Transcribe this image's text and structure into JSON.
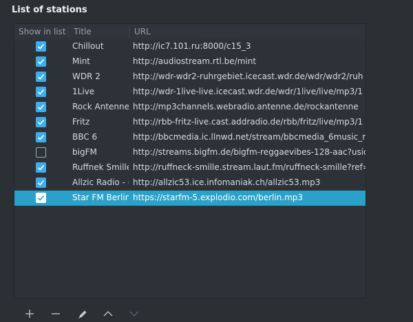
{
  "section_title": "List of stations",
  "columns": {
    "show": "Show in list",
    "title": "Title",
    "url": "URL"
  },
  "stations": [
    {
      "show": true,
      "title": "Chillout",
      "url": "http://ic7.101.ru:8000/c15_3",
      "selected": false
    },
    {
      "show": true,
      "title": "Mint",
      "url": "http://audiostream.rtl.be/mint",
      "selected": false
    },
    {
      "show": true,
      "title": "WDR 2",
      "url": "http://wdr-wdr2-ruhrgebiet.icecast.wdr.de/wdr/wdr2/ruh",
      "selected": false
    },
    {
      "show": true,
      "title": "1Live",
      "url": "http://wdr-1live-live.icecast.wdr.de/wdr/1live/live/mp3/1",
      "selected": false
    },
    {
      "show": true,
      "title": "Rock Antenne",
      "url": "http://mp3channels.webradio.antenne.de/rockantenne",
      "selected": false
    },
    {
      "show": true,
      "title": "Fritz",
      "url": "http://rbb-fritz-live.cast.addradio.de/rbb/fritz/live/mp3/1",
      "selected": false
    },
    {
      "show": true,
      "title": "BBC 6",
      "url": "http://bbcmedia.ic.llnwd.net/stream/bbcmedia_6music_m",
      "selected": false
    },
    {
      "show": false,
      "title": "bigFM",
      "url": "http://streams.bigfm.de/bigfm-reggaevibes-128-aac?usid",
      "selected": false
    },
    {
      "show": true,
      "title": "Ruffnek Smille",
      "url": "http://ruffneck-smille.stream.laut.fm/ruffneck-smille?ref=",
      "selected": false
    },
    {
      "show": true,
      "title": "Allzic Radio - (",
      "url": "http://allzic53.ice.infomaniak.ch/allzic53.mp3",
      "selected": false
    },
    {
      "show": true,
      "title": "Star FM Berlin",
      "url": "https://starfm-5.explodio.com/berlin.mp3",
      "selected": true
    }
  ],
  "toolbar": {
    "add_icon": "plus-icon",
    "remove_icon": "minus-icon",
    "edit_icon": "pencil-icon",
    "up_icon": "chevron-up-icon",
    "down_icon": "chevron-down-icon"
  },
  "colors": {
    "background": "#2b3035",
    "selection": "#2aa1c8",
    "checkbox_checked": "#3daee9"
  }
}
